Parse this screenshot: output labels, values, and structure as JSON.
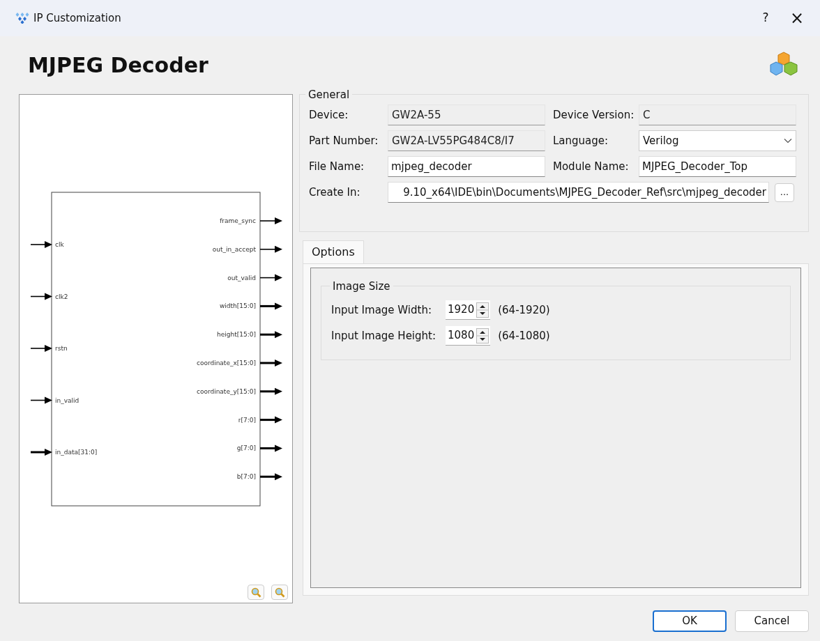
{
  "window": {
    "title": "IP Customization",
    "help": "?",
    "close": "×"
  },
  "heading": "MJPEG Decoder",
  "diagram": {
    "inputs": [
      {
        "name": "clk",
        "bus": false
      },
      {
        "name": "clk2",
        "bus": false
      },
      {
        "name": "rstn",
        "bus": false
      },
      {
        "name": "in_valid",
        "bus": false
      },
      {
        "name": "in_data[31:0]",
        "bus": true
      }
    ],
    "outputs": [
      {
        "name": "frame_sync",
        "bus": false
      },
      {
        "name": "out_in_accept",
        "bus": false
      },
      {
        "name": "out_valid",
        "bus": false
      },
      {
        "name": "width[15:0]",
        "bus": true
      },
      {
        "name": "height[15:0]",
        "bus": true
      },
      {
        "name": "coordinate_x[15:0]",
        "bus": true
      },
      {
        "name": "coordinate_y[15:0]",
        "bus": true
      },
      {
        "name": "r[7:0]",
        "bus": true
      },
      {
        "name": "g[7:0]",
        "bus": true
      },
      {
        "name": "b[7:0]",
        "bus": true
      }
    ]
  },
  "general": {
    "title": "General",
    "rows": [
      [
        {
          "label": "Device:",
          "kind": "readonly",
          "value": "GW2A-55"
        },
        {
          "label": "Device Version:",
          "kind": "readonly",
          "value": "C"
        }
      ],
      [
        {
          "label": "Part Number:",
          "kind": "readonly",
          "value": "GW2A-LV55PG484C8/I7"
        },
        {
          "label": "Language:",
          "kind": "select",
          "value": "Verilog"
        }
      ],
      [
        {
          "label": "File Name:",
          "kind": "text",
          "value": "mjpeg_decoder"
        },
        {
          "label": "Module Name:",
          "kind": "text",
          "value": "MJPEG_Decoder_Top"
        }
      ]
    ],
    "create_in": {
      "label": "Create In:",
      "value": "9.10_x64\\IDE\\bin\\Documents\\MJPEG_Decoder_Ref\\src\\mjpeg_decoder",
      "browse": "..."
    }
  },
  "tabs": [
    {
      "label": "Options",
      "selected": true
    }
  ],
  "image_size": {
    "title": "Image Size",
    "fields": [
      {
        "label": "Input Image Width:",
        "value": "1920",
        "range": "(64-1920)"
      },
      {
        "label": "Input Image Height:",
        "value": "1080",
        "range": "(64-1080)"
      }
    ]
  },
  "buttons": [
    {
      "label": "OK",
      "default": true
    },
    {
      "label": "Cancel",
      "default": false
    }
  ]
}
